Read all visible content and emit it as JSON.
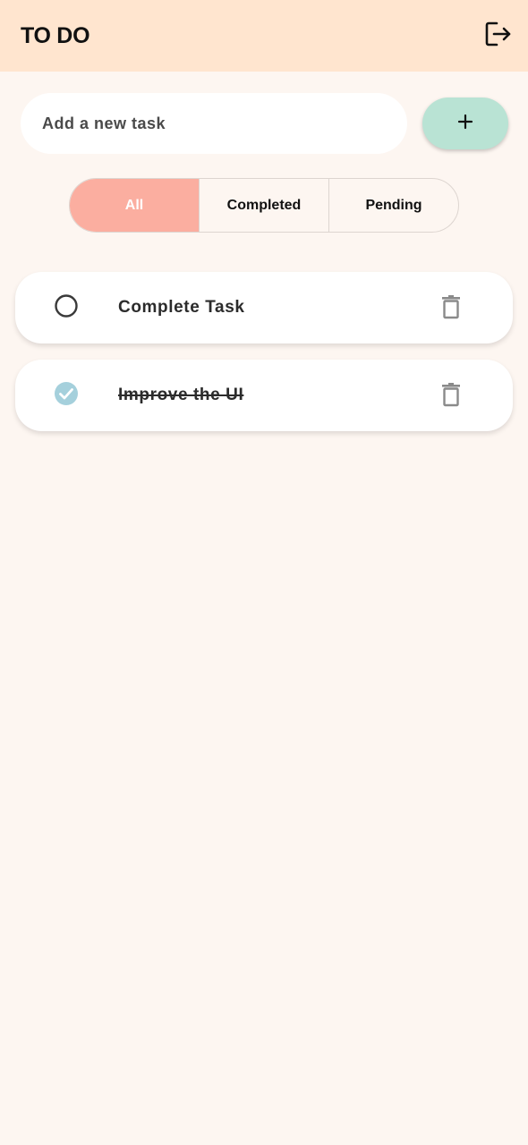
{
  "app_bar": {
    "title": "TO DO",
    "logout_icon": "logout-icon",
    "background": "#ffe5cf"
  },
  "new_task": {
    "placeholder": "Add a new task",
    "value": "",
    "add_icon": "plus-icon",
    "add_button_color": "#b9e3d4"
  },
  "filters": {
    "selected": "All",
    "active_color": "#fbaea0",
    "items": [
      {
        "label": "All",
        "active": true
      },
      {
        "label": "Completed",
        "active": false
      },
      {
        "label": "Pending",
        "active": false
      }
    ]
  },
  "tasks": [
    {
      "title": "Complete Task",
      "completed": false,
      "status_icon": "circle-outline-icon",
      "delete_icon": "trash-icon"
    },
    {
      "title": "Improve the UI",
      "completed": true,
      "status_icon": "check-circle-icon",
      "delete_icon": "trash-icon"
    }
  ],
  "colors": {
    "page_background": "#fdf6f1",
    "check_color": "#a5d0dc",
    "trash_color": "#8a8a8a"
  }
}
